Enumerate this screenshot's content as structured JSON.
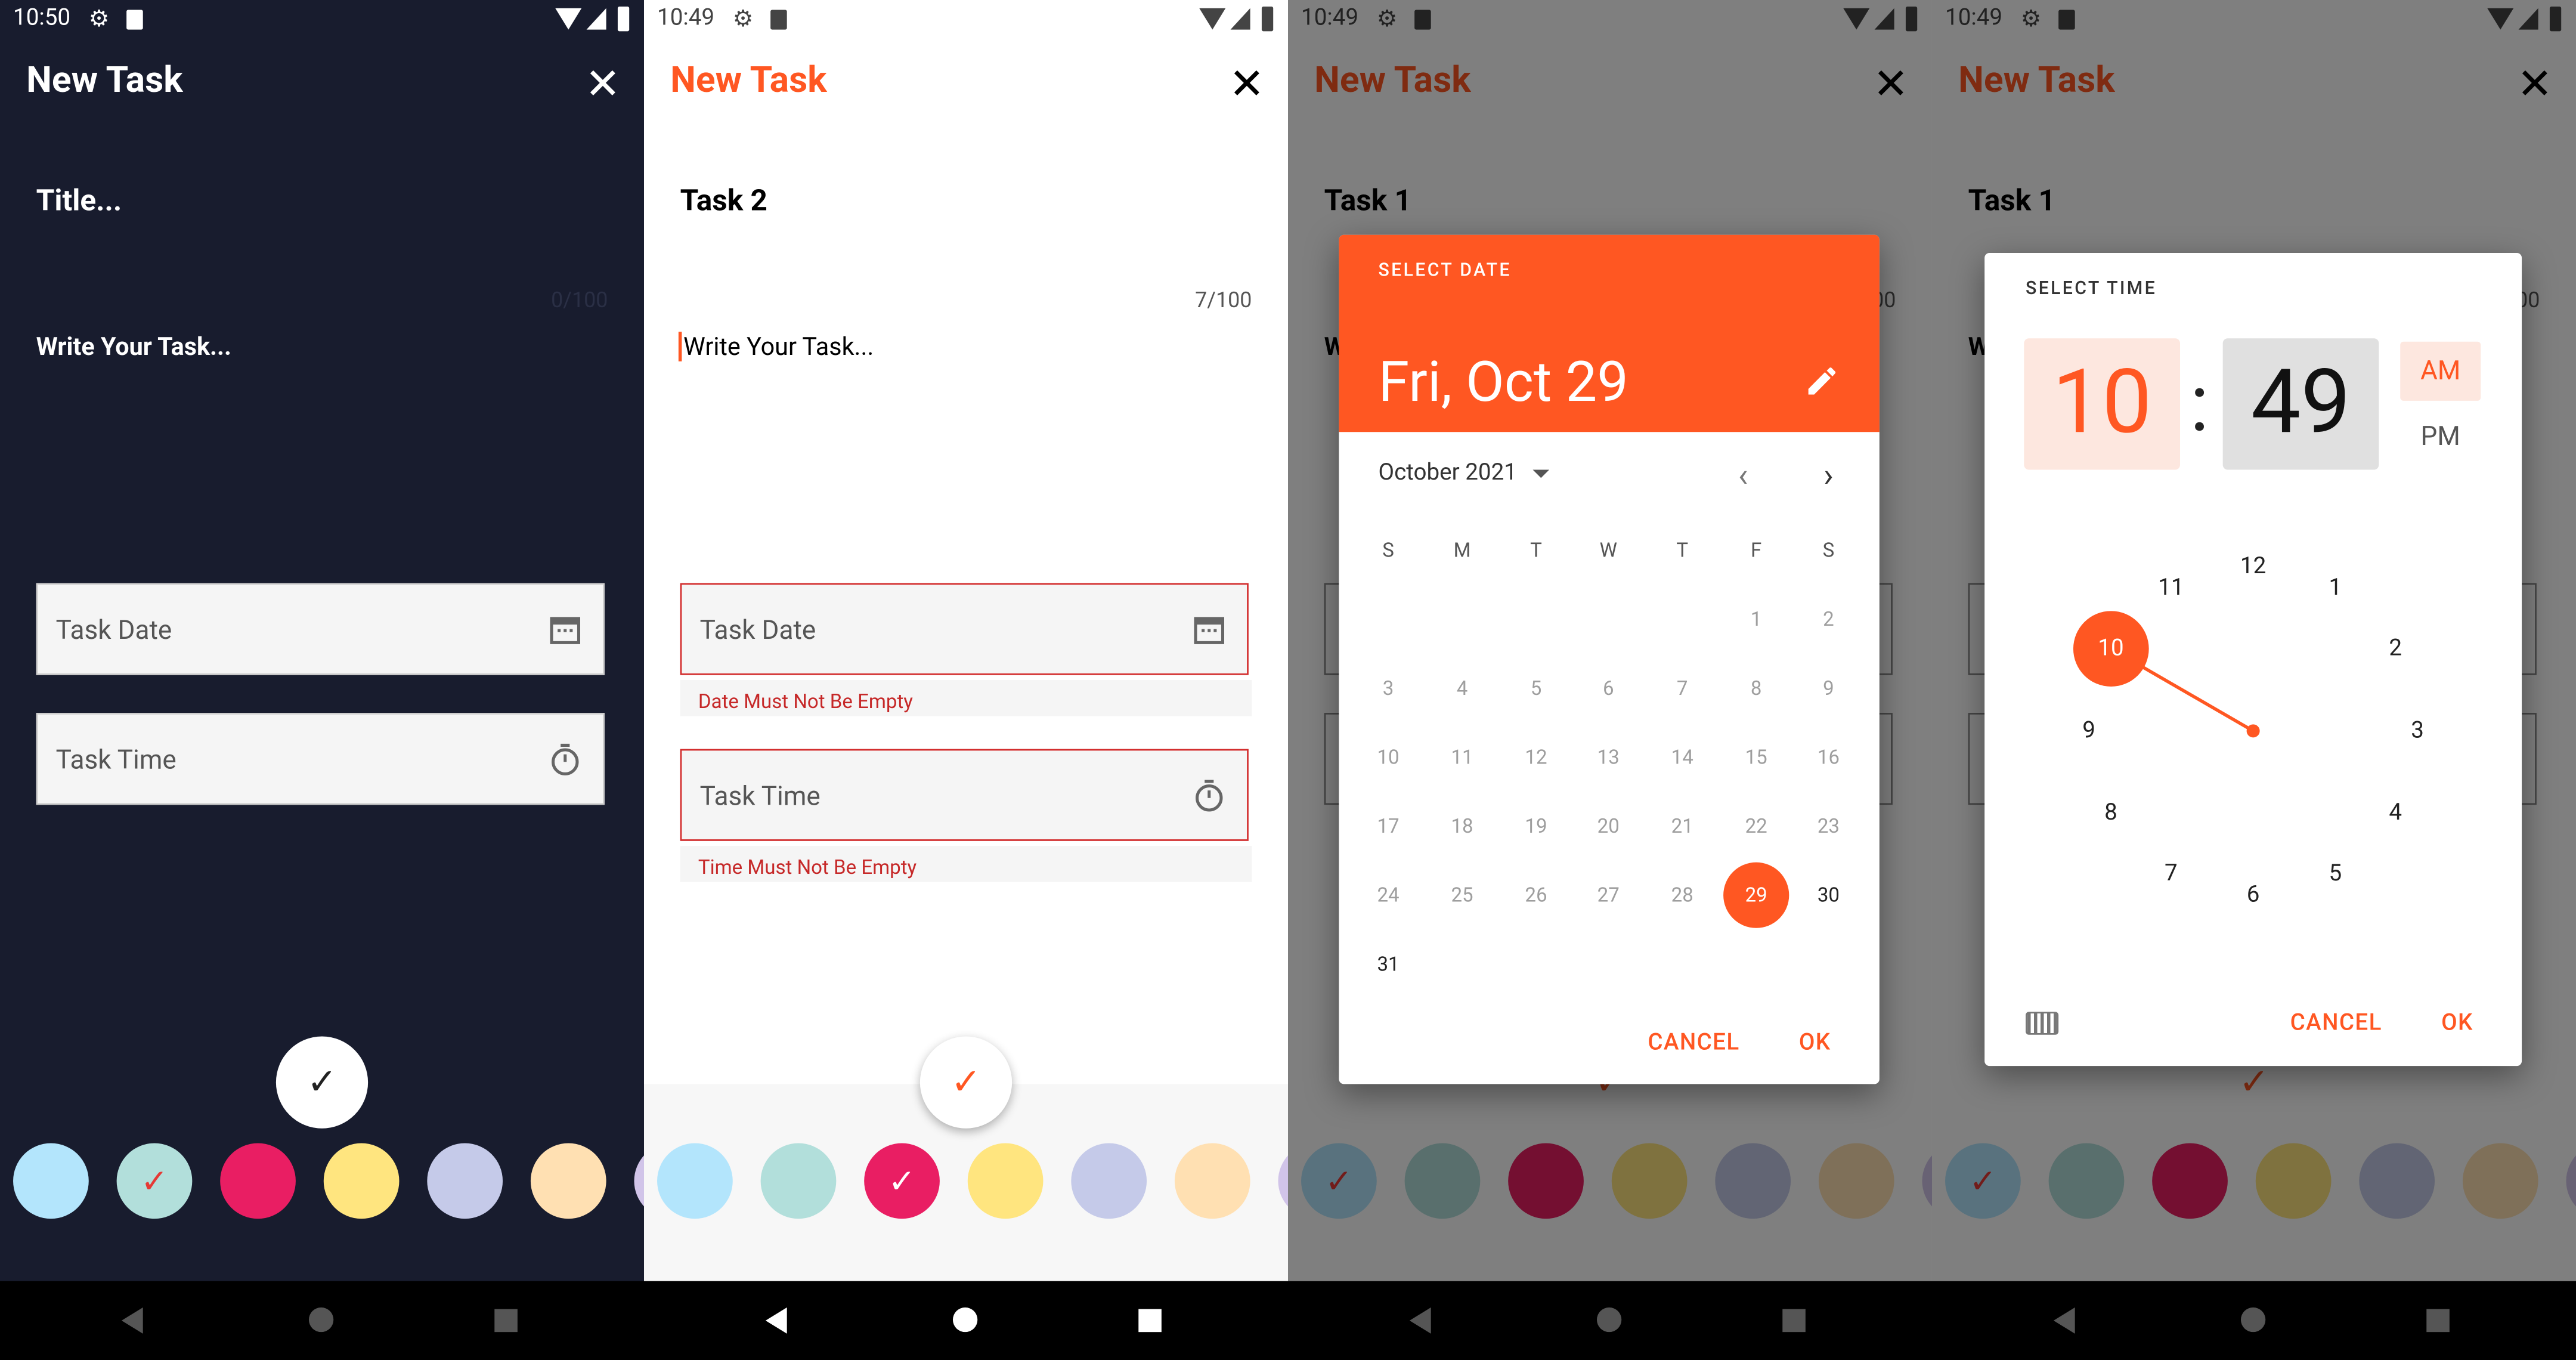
{
  "colors": {
    "accent": "#ff5722",
    "dark_bg": "#181c2e",
    "error": "#c62828"
  },
  "screen1": {
    "status_time": "10:50",
    "title": "New Task",
    "close": "✕",
    "title_placeholder": "Title...",
    "counter": "0/100",
    "task_placeholder": "Write Your Task...",
    "date_label": "Task Date",
    "time_label": "Task Time",
    "swatches": [
      "#b3e5fc",
      "#b2dfdb",
      "#e91e63",
      "#ffe57f",
      "#c5cae9",
      "#ffe0b2",
      "#d1c4e9"
    ],
    "selected_swatch": 1
  },
  "screen2": {
    "status_time": "10:49",
    "title": "New Task",
    "close": "✕",
    "title_value": "Task 2",
    "counter": "7/100",
    "task_placeholder": "Write Your Task...",
    "date_label": "Task Date",
    "date_error": "Date Must Not Be Empty",
    "time_label": "Task Time",
    "time_error": "Time Must Not Be Empty",
    "swatches": [
      "#b3e5fc",
      "#b2dfdb",
      "#e91e63",
      "#ffe57f",
      "#c5cae9",
      "#ffe0b2",
      "#d1c4e9"
    ],
    "selected_swatch": 2
  },
  "screen3": {
    "status_time": "10:49",
    "title": "New Task",
    "close": "✕",
    "title_value": "Task 1",
    "counter_partial": "00",
    "task_partial": "W",
    "dialog": {
      "header": "SELECT DATE",
      "date": "Fri, Oct 29",
      "month": "October 2021",
      "weekdays": [
        "S",
        "M",
        "T",
        "W",
        "T",
        "F",
        "S"
      ],
      "days": [
        "1",
        "2",
        "3",
        "4",
        "5",
        "6",
        "7",
        "8",
        "9",
        "10",
        "11",
        "12",
        "13",
        "14",
        "15",
        "16",
        "17",
        "18",
        "19",
        "20",
        "21",
        "22",
        "23",
        "24",
        "25",
        "26",
        "27",
        "28",
        "29",
        "30",
        "31"
      ],
      "first_weekday": 5,
      "selected_day": 29,
      "cancel": "CANCEL",
      "ok": "OK"
    },
    "swatches": [
      "#b3e5fc",
      "#b2dfdb",
      "#e91e63",
      "#ffe57f",
      "#c5cae9",
      "#ffe0b2",
      "#d1c4e9"
    ],
    "selected_swatch": 0
  },
  "screen4": {
    "status_time": "10:49",
    "title": "New Task",
    "close": "✕",
    "title_value": "Task 1",
    "counter_partial": "00",
    "task_partial": "W",
    "dialog": {
      "header": "SELECT TIME",
      "hour": "10",
      "colon": ":",
      "minute": "49",
      "am": "AM",
      "pm": "PM",
      "clock_numbers": [
        "12",
        "1",
        "2",
        "3",
        "4",
        "5",
        "6",
        "7",
        "8",
        "9",
        "10",
        "11"
      ],
      "selected_hour": 10,
      "cancel": "CANCEL",
      "ok": "OK"
    },
    "swatches": [
      "#b3e5fc",
      "#b2dfdb",
      "#e91e63",
      "#ffe57f",
      "#c5cae9",
      "#ffe0b2",
      "#d1c4e9"
    ],
    "selected_swatch": 0
  },
  "navbar": {
    "back": "◀",
    "home": "●",
    "recents": "■"
  }
}
